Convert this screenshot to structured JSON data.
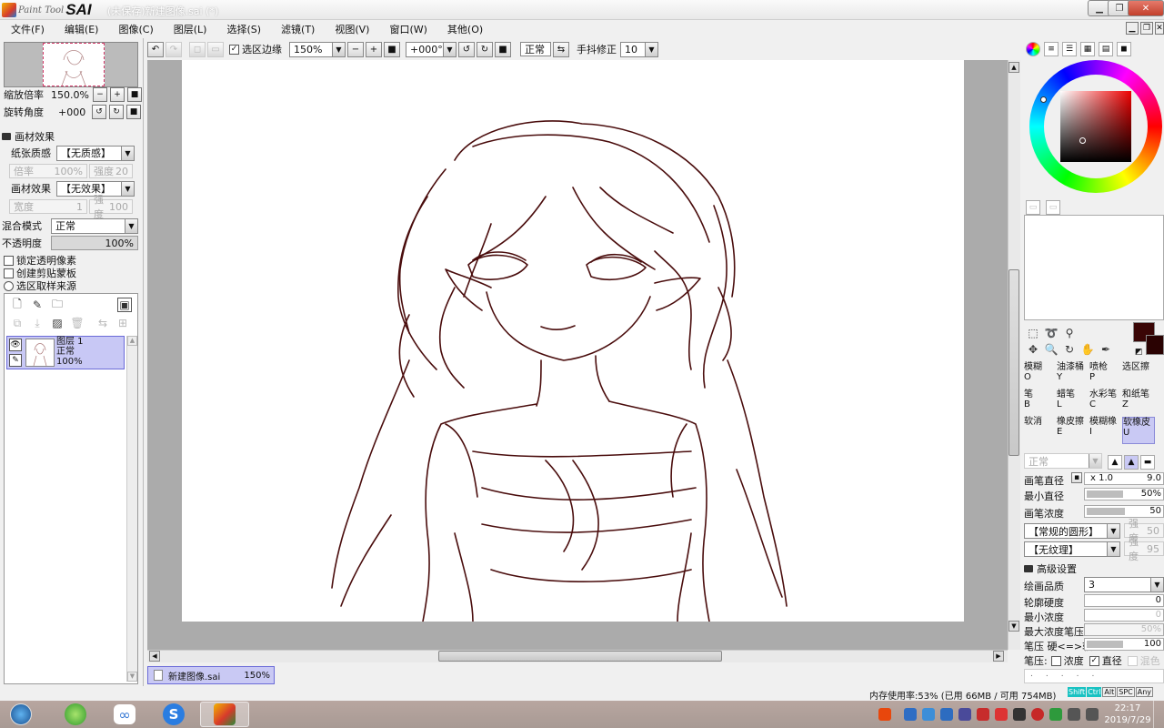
{
  "app": {
    "logo_small": "Paint Tool",
    "logo_big": "SAI",
    "title": "(未保存)新建图像.sai (*)"
  },
  "menu": [
    "文件(F)",
    "编辑(E)",
    "图像(C)",
    "图层(L)",
    "选择(S)",
    "滤镜(T)",
    "视图(V)",
    "窗口(W)",
    "其他(O)"
  ],
  "navigator": {
    "zoom_label": "缩放倍率",
    "zoom_value": "150.0%",
    "rotate_label": "旋转角度",
    "rotate_value": "+000"
  },
  "paper_effect": {
    "section": "画材效果",
    "texture_label": "纸张质感",
    "texture_value": "【无质感】",
    "scale_label": "倍率",
    "scale_value": "100%",
    "strength_label": "强度",
    "strength_value": "20",
    "effect_label": "画材效果",
    "effect_value": "【无效果】",
    "width_label": "宽度",
    "width_value": "1",
    "strength2_label": "强度",
    "strength2_value": "100"
  },
  "blend": {
    "mode_label": "混合模式",
    "mode_value": "正常",
    "opacity_label": "不透明度",
    "opacity_value": "100%",
    "opacity_fraction": 1.0
  },
  "layer_options": {
    "lock_alpha": "锁定透明像素",
    "clipping": "创建剪贴蒙板",
    "select_source": "选区取样来源"
  },
  "layer": {
    "name": "图层 1",
    "mode": "正常",
    "opacity": "100%"
  },
  "toolbar": {
    "selection_edge": "选区边缘",
    "zoom": "150%",
    "angle": "+000°",
    "mode": "正常",
    "stabilizer_label": "手抖修正",
    "stabilizer_value": "10"
  },
  "doc_tab": {
    "name": "新建图像.sai",
    "zoom": "150%"
  },
  "colors": {
    "primary": "#3a0606",
    "canvas_bg": "#ababab",
    "accent": "#c9c9f4",
    "stroke": "#4a0d0d"
  },
  "tools": [
    {
      "name": "模糊",
      "key": "O"
    },
    {
      "name": "油漆桶",
      "key": "Y"
    },
    {
      "name": "喷枪",
      "key": "P"
    },
    {
      "name": "选区擦",
      "key": ""
    },
    {
      "name": "笔",
      "key": "B"
    },
    {
      "name": "蜡笔",
      "key": "L"
    },
    {
      "name": "水彩笔",
      "key": "C"
    },
    {
      "name": "和纸笔",
      "key": "Z"
    },
    {
      "name": "软消",
      "key": ""
    },
    {
      "name": "橡皮擦",
      "key": "E"
    },
    {
      "name": "模糊橡",
      "key": "I"
    },
    {
      "name": "软橡皮",
      "key": "U"
    }
  ],
  "brush": {
    "mode": "正常",
    "size_label": "画笔直径",
    "size_mult": "x 1.0",
    "size_value": "9.0",
    "min_size_label": "最小直径",
    "min_size_value": "50%",
    "density_label": "画笔浓度",
    "density_value": "50",
    "shape_value": "【常规的圆形】",
    "shape_strength_label": "强度",
    "shape_strength_value": "50",
    "texture_value": "【无纹理】",
    "texture_strength_label": "强度",
    "texture_strength_value": "95",
    "advanced_label": "高级设置",
    "quality_label": "绘画品质",
    "quality_value": "3",
    "edge_label": "轮廓硬度",
    "edge_value": "0",
    "min_density_label": "最小浓度",
    "min_density_value": "0",
    "max_pressure_label": "最大浓度笔压",
    "max_pressure_value": "50%",
    "pressure_label": "笔压 硬<=>软",
    "pressure_value": "100",
    "pressure_opts_label": "笔压:",
    "opt_density": "浓度",
    "opt_diameter": "直径",
    "opt_blend": "混色"
  },
  "status": {
    "memory": "内存使用率:53% (已用 66MB / 可用 754MB)",
    "keys": [
      "Shift",
      "Ctrl",
      "Alt",
      "SPC",
      "Any"
    ]
  },
  "taskbar": {
    "time": "22:17",
    "date": "2019/7/29"
  }
}
